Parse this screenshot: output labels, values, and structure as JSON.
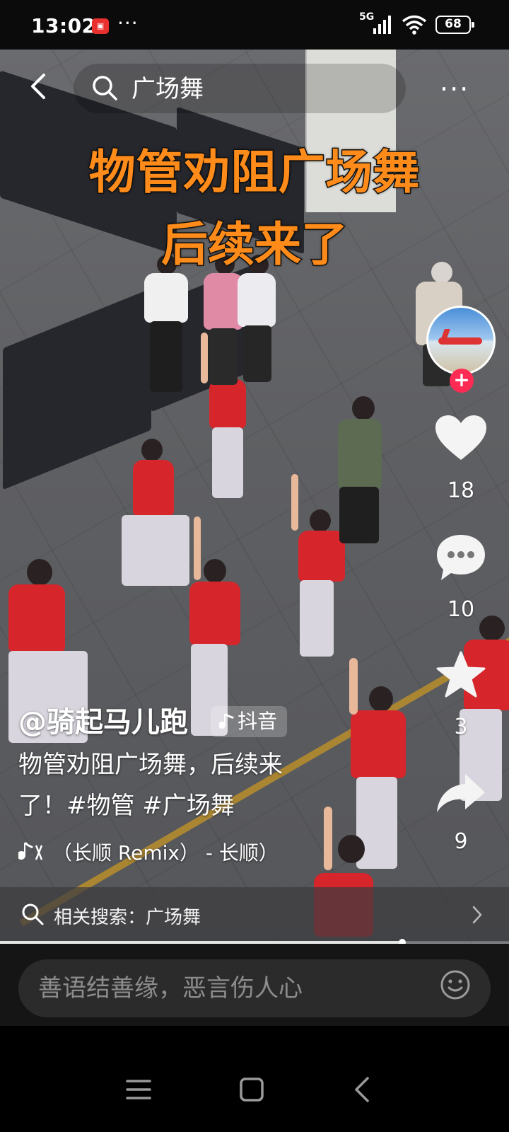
{
  "status_bar": {
    "time": "13:02",
    "notification_dots": "···",
    "network": "5G",
    "battery": "68"
  },
  "top_bar": {
    "search_query": "广场舞",
    "more": "···"
  },
  "video": {
    "headline_line1": "物管劝阻广场舞",
    "headline_line2": "后续来了"
  },
  "side_rail": {
    "follow_symbol": "+",
    "likes": "18",
    "comments": "10",
    "favorites": "3",
    "shares": "9"
  },
  "caption": {
    "author": "@骑起马儿跑",
    "platform_tag": "抖音",
    "text_line1": "物管劝阻广场舞，后续来",
    "text_line2": "了！#物管 #广场舞",
    "music": "（长顺 Remix） - 长顺）"
  },
  "related_search": {
    "label": "相关搜索：广场舞"
  },
  "progress": {
    "fraction": 0.79
  },
  "comment_bar": {
    "placeholder": "善语结善缘，恶言伤人心"
  },
  "colors": {
    "headline": "#ff8c1a",
    "follow": "#fe2c55",
    "shirt": "#d7262b"
  },
  "icons": {
    "back": "back-arrow-icon",
    "search": "search-icon",
    "like": "heart-icon",
    "comment": "comment-bubble-icon",
    "favorite": "star-icon",
    "share": "share-arrow-icon",
    "emoji": "emoji-icon",
    "music": "music-note-icon"
  }
}
